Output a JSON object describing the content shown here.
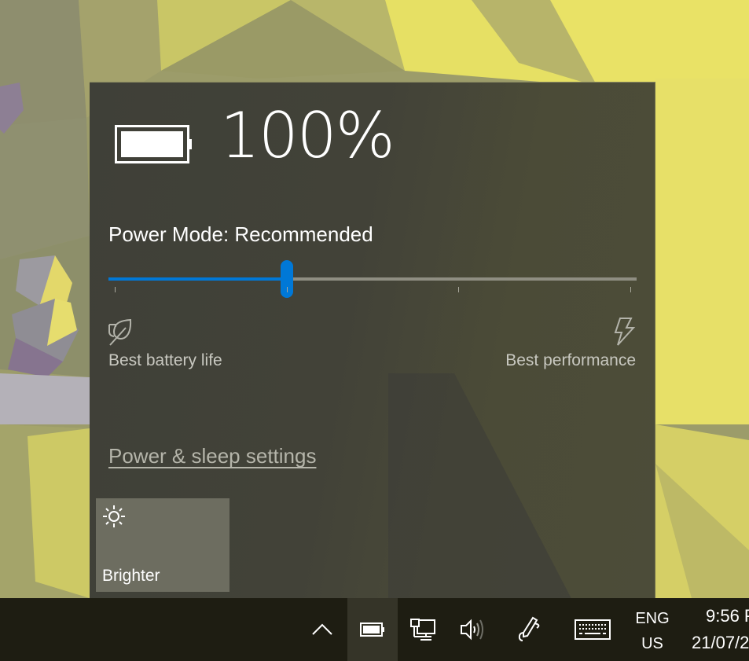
{
  "battery": {
    "percent_label": "100%",
    "level_percent": 100,
    "icon": "battery-full-icon"
  },
  "power_mode": {
    "label": "Power Mode: Recommended",
    "positions": 4,
    "selected_index": 1,
    "left_label": "Best battery life",
    "left_icon": "leaf-icon",
    "right_label": "Best performance",
    "right_icon": "lightning-icon"
  },
  "links": {
    "power_sleep_settings": "Power & sleep settings"
  },
  "quick_actions": [
    {
      "label": "Brighter",
      "icon": "sun-icon"
    }
  ],
  "taskbar": {
    "tray_icons": [
      {
        "name": "show-hidden-icons",
        "icon": "chevron-up-icon"
      },
      {
        "name": "battery",
        "icon": "battery-icon",
        "active": true
      },
      {
        "name": "network",
        "icon": "network-ethernet-icon"
      },
      {
        "name": "volume",
        "icon": "speaker-icon"
      },
      {
        "name": "windows-ink",
        "icon": "pen-icon"
      },
      {
        "name": "touch-keyboard",
        "icon": "keyboard-icon"
      }
    ],
    "language": {
      "line1": "ENG",
      "line2": "US"
    },
    "clock": {
      "time": "9:56 P",
      "date": "21/07/2"
    }
  },
  "colors": {
    "accent": "#0078d7",
    "panel": "#424238",
    "taskbar": "#1e1d12",
    "tile": "#6d6d60"
  }
}
